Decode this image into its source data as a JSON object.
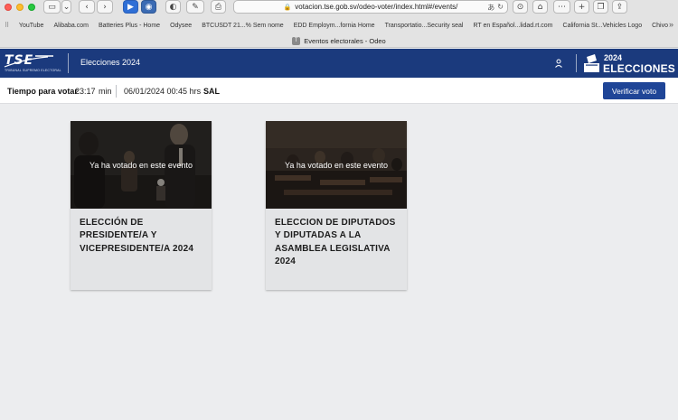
{
  "browser": {
    "url": "votacion.tse.gob.sv/odeo-voter/index.html#/events/",
    "tab_title": "Eventos electorales - Odeo",
    "tab_favicon": "T",
    "bookmarks": [
      "YouTube",
      "Alibaba.com",
      "Batteries Plus - Home",
      "Odysee",
      "BTCUSDT 21...% Sem nome",
      "EDD Employm...fornia Home",
      "Transportatio...Security seal",
      "RT en Español...lidad.rt.com",
      "California St...Vehicles Logo",
      "Chivo"
    ]
  },
  "header": {
    "logo_text": "TSE",
    "logo_subtext": "TRIBUNAL SUPREMO ELECTORAL",
    "title": "Elecciones 2024",
    "brand_year": "2024",
    "brand_word": "ELECCIONES"
  },
  "infobar": {
    "time_label": "Tiempo para votar",
    "time_value": "23:17",
    "time_unit": "min",
    "datetime": "06/01/2024 00:45 hrs",
    "timezone": "SAL",
    "verify_label": "Verificar voto"
  },
  "events": [
    {
      "status": "Ya ha votado en este evento",
      "title": "ELECCIÓN DE PRESIDENTE/A Y VICEPRESIDENTE/A 2024"
    },
    {
      "status": "Ya ha votado en este evento",
      "title": "ELECCION DE DIPUTADOS Y DIPUTADAS A LA ASAMBLEA LEGISLATIVA 2024"
    }
  ],
  "colors": {
    "header_bg": "#1b3a7d",
    "button_bg": "#1f4597",
    "page_bg": "#ecedef"
  }
}
